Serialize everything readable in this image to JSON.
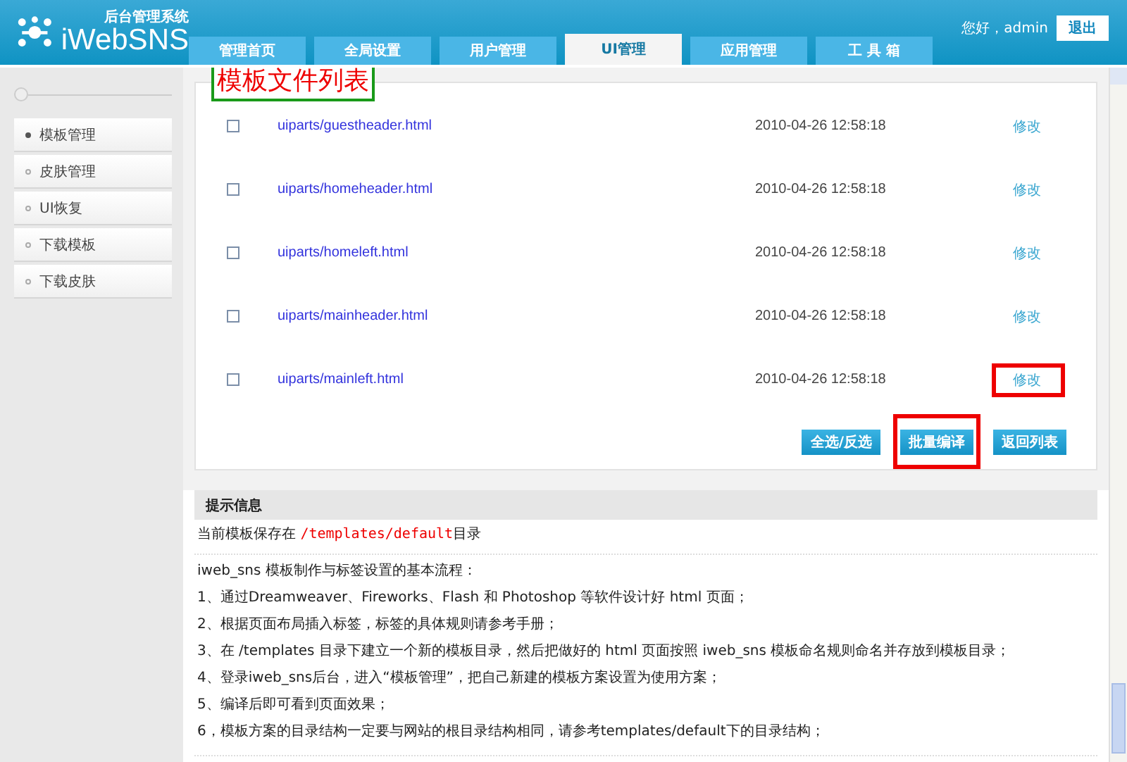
{
  "header": {
    "logo_subtitle": "后台管理系统",
    "logo": "iWebSNS",
    "greeting": "您好，admin",
    "logout": "退出",
    "tabs": [
      {
        "label": "管理首页",
        "selected": false
      },
      {
        "label": "全局设置",
        "selected": false
      },
      {
        "label": "用户管理",
        "selected": false
      },
      {
        "label": "UI管理",
        "selected": true
      },
      {
        "label": "应用管理",
        "selected": false
      },
      {
        "label": "工 具 箱",
        "selected": false
      }
    ]
  },
  "sidebar": {
    "items": [
      {
        "label": "模板管理",
        "selected": true
      },
      {
        "label": "皮肤管理",
        "selected": false
      },
      {
        "label": "UI恢复",
        "selected": false
      },
      {
        "label": "下载模板",
        "selected": false
      },
      {
        "label": "下载皮肤",
        "selected": false
      }
    ]
  },
  "annotation": "模板文件列表",
  "files": [
    {
      "checked": false,
      "name": "uiparts/guestheader.html",
      "time": "2010-04-26 12:58:18",
      "action": "修改",
      "highlighted": false
    },
    {
      "checked": false,
      "name": "uiparts/homeheader.html",
      "time": "2010-04-26 12:58:18",
      "action": "修改",
      "highlighted": false
    },
    {
      "checked": false,
      "name": "uiparts/homeleft.html",
      "time": "2010-04-26 12:58:18",
      "action": "修改",
      "highlighted": false
    },
    {
      "checked": false,
      "name": "uiparts/mainheader.html",
      "time": "2010-04-26 12:58:18",
      "action": "修改",
      "highlighted": false
    },
    {
      "checked": false,
      "name": "uiparts/mainleft.html",
      "time": "2010-04-26 12:58:18",
      "action": "修改",
      "highlighted": true
    }
  ],
  "buttons": [
    {
      "label": "全选/反选",
      "highlighted": false
    },
    {
      "label": "批量编译",
      "highlighted": true
    },
    {
      "label": "返回列表",
      "highlighted": false
    }
  ],
  "tips": {
    "title": "提示信息",
    "path_prefix": "当前模板保存在",
    "path": "/templates/default",
    "path_suffix": "目录",
    "lines": [
      "iweb_sns 模板制作与标签设置的基本流程：",
      "1、通过Dreamweaver、Fireworks、Flash 和 Photoshop 等软件设计好 html 页面；",
      "2、根据页面布局插入标签，标签的具体规则请参考手册；",
      "3、在 /templates 目录下建立一个新的模板目录，然后把做好的 html 页面按照 iweb_sns 模板命名规则命名并存放到模板目录；",
      "4、登录iweb_sns后台，进入“模板管理”，把自己新建的模板方案设置为使用方案；",
      "5、编译后即可看到页面效果；",
      "6，模板方案的目录结构一定要与网站的根目录结构相同，请参考templates/default下的目录结构；"
    ]
  }
}
